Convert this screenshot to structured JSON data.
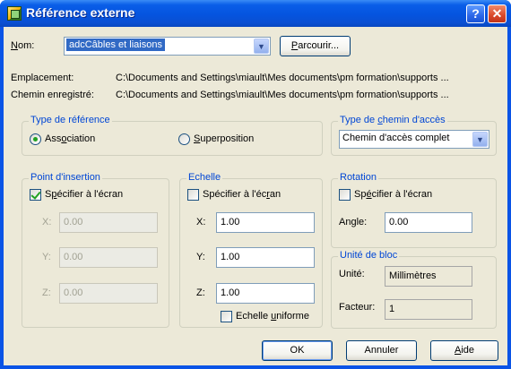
{
  "window": {
    "title": "Référence externe",
    "help_glyph": "?",
    "close_glyph": "✕"
  },
  "nom": {
    "label_hot": "N",
    "label_rest": "om:",
    "value": "adcCâbles et liaisons",
    "browse_hot": "P",
    "browse_rest": "arcourir..."
  },
  "emplacement": {
    "label": "Emplacement:",
    "value": "C:\\Documents and Settings\\miault\\Mes documents\\pm formation\\supports ..."
  },
  "chemin_enregistre": {
    "label": "Chemin enregistré:",
    "value": "C:\\Documents and Settings\\miault\\Mes documents\\pm formation\\supports ..."
  },
  "type_reference": {
    "title": "Type de référence",
    "association_pre": "Ass",
    "association_hot": "o",
    "association_post": "ciation",
    "association_selected": true,
    "superposition_hot": "S",
    "superposition_rest": "uperposition",
    "superposition_selected": false
  },
  "type_chemin": {
    "title_pre": "Type de ",
    "title_hot": "c",
    "title_post": "hemin d'accès",
    "value": "Chemin d'accès complet"
  },
  "point_insertion": {
    "title": "Point d'insertion",
    "specify_pre": "S",
    "specify_hot": "p",
    "specify_post": "écifier à l'écran",
    "specify_checked": true,
    "x_label": "X:",
    "x_value": "0.00",
    "y_label": "Y:",
    "y_value": "0.00",
    "z_label": "Z:",
    "z_value": "0.00"
  },
  "echelle": {
    "title": "Echelle",
    "specify_pre": "Spécifier à l'éc",
    "specify_hot": "r",
    "specify_post": "an",
    "specify_checked": false,
    "x_label": "X:",
    "x_value": "1.00",
    "y_label": "Y:",
    "y_value": "1.00",
    "z_label": "Z:",
    "z_value": "1.00",
    "uniform_pre": "Echelle ",
    "uniform_hot": "u",
    "uniform_post": "niforme",
    "uniform_checked": false
  },
  "rotation": {
    "title": "Rotation",
    "specify_pre": "Sp",
    "specify_hot": "é",
    "specify_post": "cifier à l'écran",
    "specify_checked": false,
    "angle_label": "Angle:",
    "angle_value": "0.00"
  },
  "unite_bloc": {
    "title": "Unité de bloc",
    "unite_label": "Unité:",
    "unite_value": "Millimètres",
    "facteur_label": "Facteur:",
    "facteur_value": "1"
  },
  "buttons": {
    "ok": "OK",
    "annuler": "Annuler",
    "aide_hot": "A",
    "aide_rest": "ide"
  }
}
